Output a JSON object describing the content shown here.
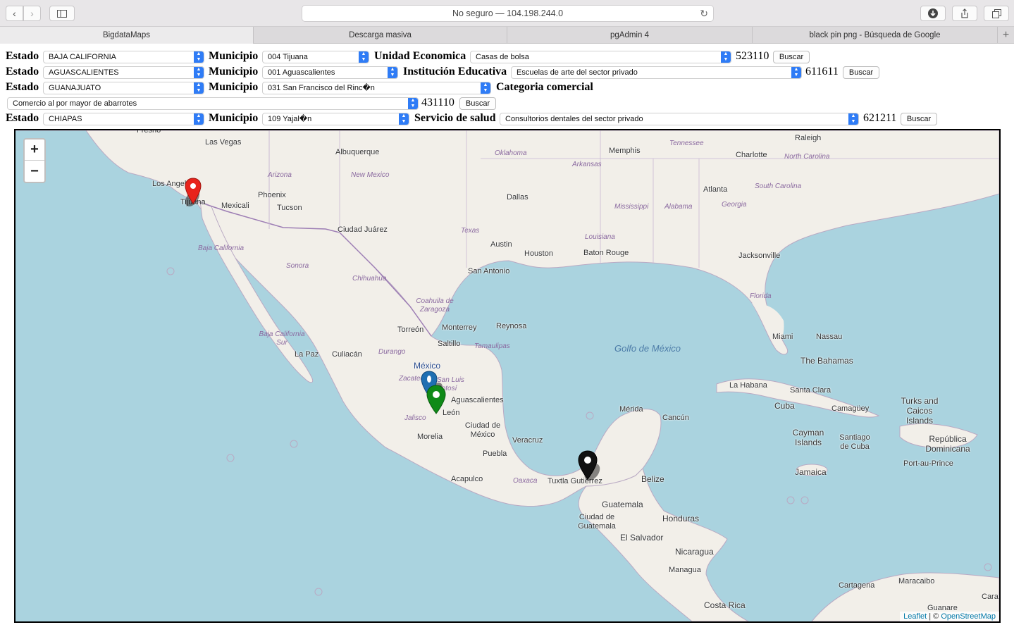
{
  "browser": {
    "url": "No seguro — 104.198.244.0",
    "tabs": [
      "BigdataMaps",
      "Descarga masiva",
      "pgAdmin 4",
      "black pin png - Búsqueda de Google"
    ],
    "new_tab": "+"
  },
  "rows": [
    {
      "estado_label": "Estado",
      "estado": "BAJA CALIFORNIA",
      "municipio_label": "Municipio",
      "municipio": "004 Tijuana",
      "type_label": "Unidad Economica",
      "category": "Casas de bolsa",
      "code": "523110",
      "button": "Buscar"
    },
    {
      "estado_label": "Estado",
      "estado": "AGUASCALIENTES",
      "municipio_label": "Municipio",
      "municipio": "001 Aguascalientes",
      "type_label": "Institución Educativa",
      "category": "Escuelas de arte del sector privado",
      "code": "611611",
      "button": "Buscar"
    },
    {
      "estado_label": "Estado",
      "estado": "GUANAJUATO",
      "municipio_label": "Municipio",
      "municipio": "031 San Francisco del Rinc�n",
      "type_label": "Categoria comercial",
      "category": "Comercio al por mayor de abarrotes",
      "code": "431110",
      "button": "Buscar"
    },
    {
      "estado_label": "Estado",
      "estado": "CHIAPAS",
      "municipio_label": "Municipio",
      "municipio": "109 Yajal�n",
      "type_label": "Servicio de salud",
      "category": "Consultorios dentales del sector privado",
      "code": "621211",
      "button": "Buscar"
    }
  ],
  "map": {
    "zoom_in": "+",
    "zoom_out": "−",
    "attribution_leaflet": "Leaflet",
    "attribution_sep": " | © ",
    "attribution_osm": "OpenStreetMap",
    "places": [
      "Fresno",
      "Las Vegas",
      "Albuquerque",
      "Memphis",
      "Raleigh",
      "Charlotte",
      "Los Angeles",
      "Phoenix",
      "Tucson",
      "Mexicali",
      "Tijuana",
      "Dallas",
      "Atlanta",
      "Ciudad Juárez",
      "Austin",
      "Houston",
      "Baton Rouge",
      "Jacksonville",
      "San Antonio",
      "Torreón",
      "Monterrey",
      "Reynosa",
      "Saltillo",
      "Culiacán",
      "La Paz",
      "México",
      "Aguascalientes",
      "León",
      "Ciudad de México",
      "Morelia",
      "Veracruz",
      "Puebla",
      "Acapulco",
      "Tuxtla Gutiérrez",
      "Mérida",
      "Cancún",
      "Belize",
      "Guatemala",
      "Ciudad de Guatemala",
      "Honduras",
      "El Salvador",
      "Nicaragua",
      "Managua",
      "Costa Rica",
      "Miami",
      "Nassau",
      "The Bahamas",
      "La Habana",
      "Santa Clara",
      "Cuba",
      "Camagüey",
      "Cayman Islands",
      "Santiago de Cuba",
      "Jamaica",
      "Turks and Caicos Islands",
      "República Dominicana",
      "Port-au-Prince",
      "Cartagena",
      "Maracaibo",
      "Guanare",
      "Cara"
    ],
    "states": [
      "Tennessee",
      "Oklahoma",
      "Arkansas",
      "North Carolina",
      "Arizona",
      "New Mexico",
      "South Carolina",
      "Mississippi",
      "Alabama",
      "Georgia",
      "Texas",
      "Louisiana",
      "Baja California",
      "Sonora",
      "Chihuahua",
      "Florida",
      "Coahuila de Zaragoza",
      "Tamaulipas",
      "Durango",
      "Baja California Sur",
      "Zacatecas",
      "San Luis Potosí",
      "Jalisco",
      "Oaxaca"
    ],
    "sea": "Golfo de México",
    "markers": [
      {
        "color": "#e8231b",
        "label": "Tijuana"
      },
      {
        "color": "#1f6fb2",
        "label": "Aguascalientes"
      },
      {
        "color": "#0f8a17",
        "label": "San Francisco del Rincón"
      },
      {
        "color": "#111111",
        "label": "Yajalón"
      }
    ]
  }
}
